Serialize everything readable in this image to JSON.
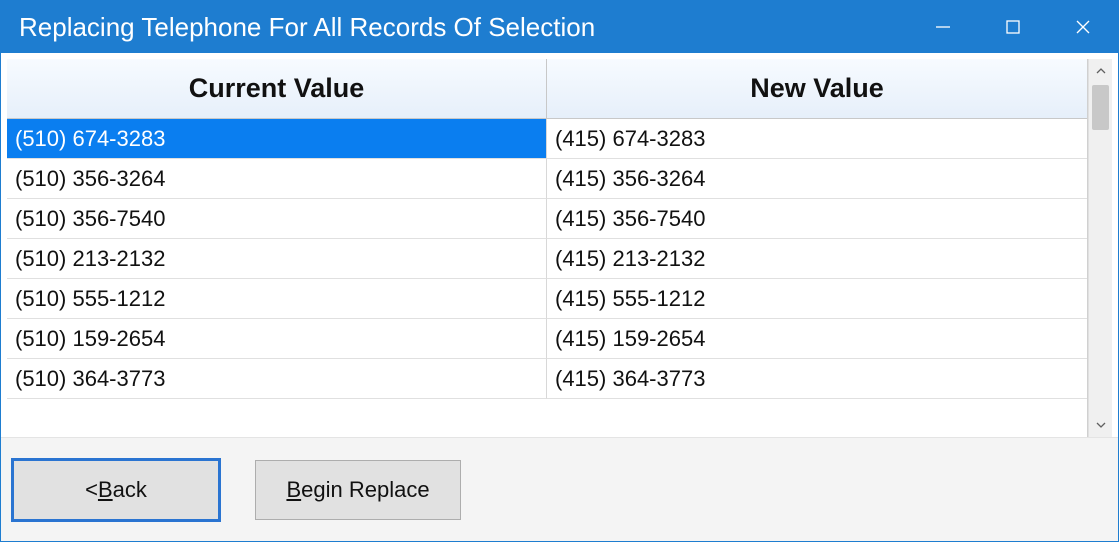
{
  "window": {
    "title": "Replacing Telephone For All Records Of Selection"
  },
  "columns": {
    "current": "Current Value",
    "new": "New Value"
  },
  "rows": [
    {
      "current": "(510) 674-3283",
      "new": "(415) 674-3283",
      "selected": true
    },
    {
      "current": "(510) 356-3264",
      "new": "(415) 356-3264",
      "selected": false
    },
    {
      "current": "(510) 356-7540",
      "new": "(415) 356-7540",
      "selected": false
    },
    {
      "current": "(510) 213-2132",
      "new": "(415) 213-2132",
      "selected": false
    },
    {
      "current": "(510) 555-1212",
      "new": "(415) 555-1212",
      "selected": false
    },
    {
      "current": "(510) 159-2654",
      "new": "(415) 159-2654",
      "selected": false
    },
    {
      "current": "(510) 364-3773",
      "new": "(415) 364-3773",
      "selected": false
    }
  ],
  "buttons": {
    "back_prefix": "< ",
    "back_ul": "B",
    "back_rest": "ack",
    "begin_ul": "B",
    "begin_rest": "egin Replace"
  }
}
